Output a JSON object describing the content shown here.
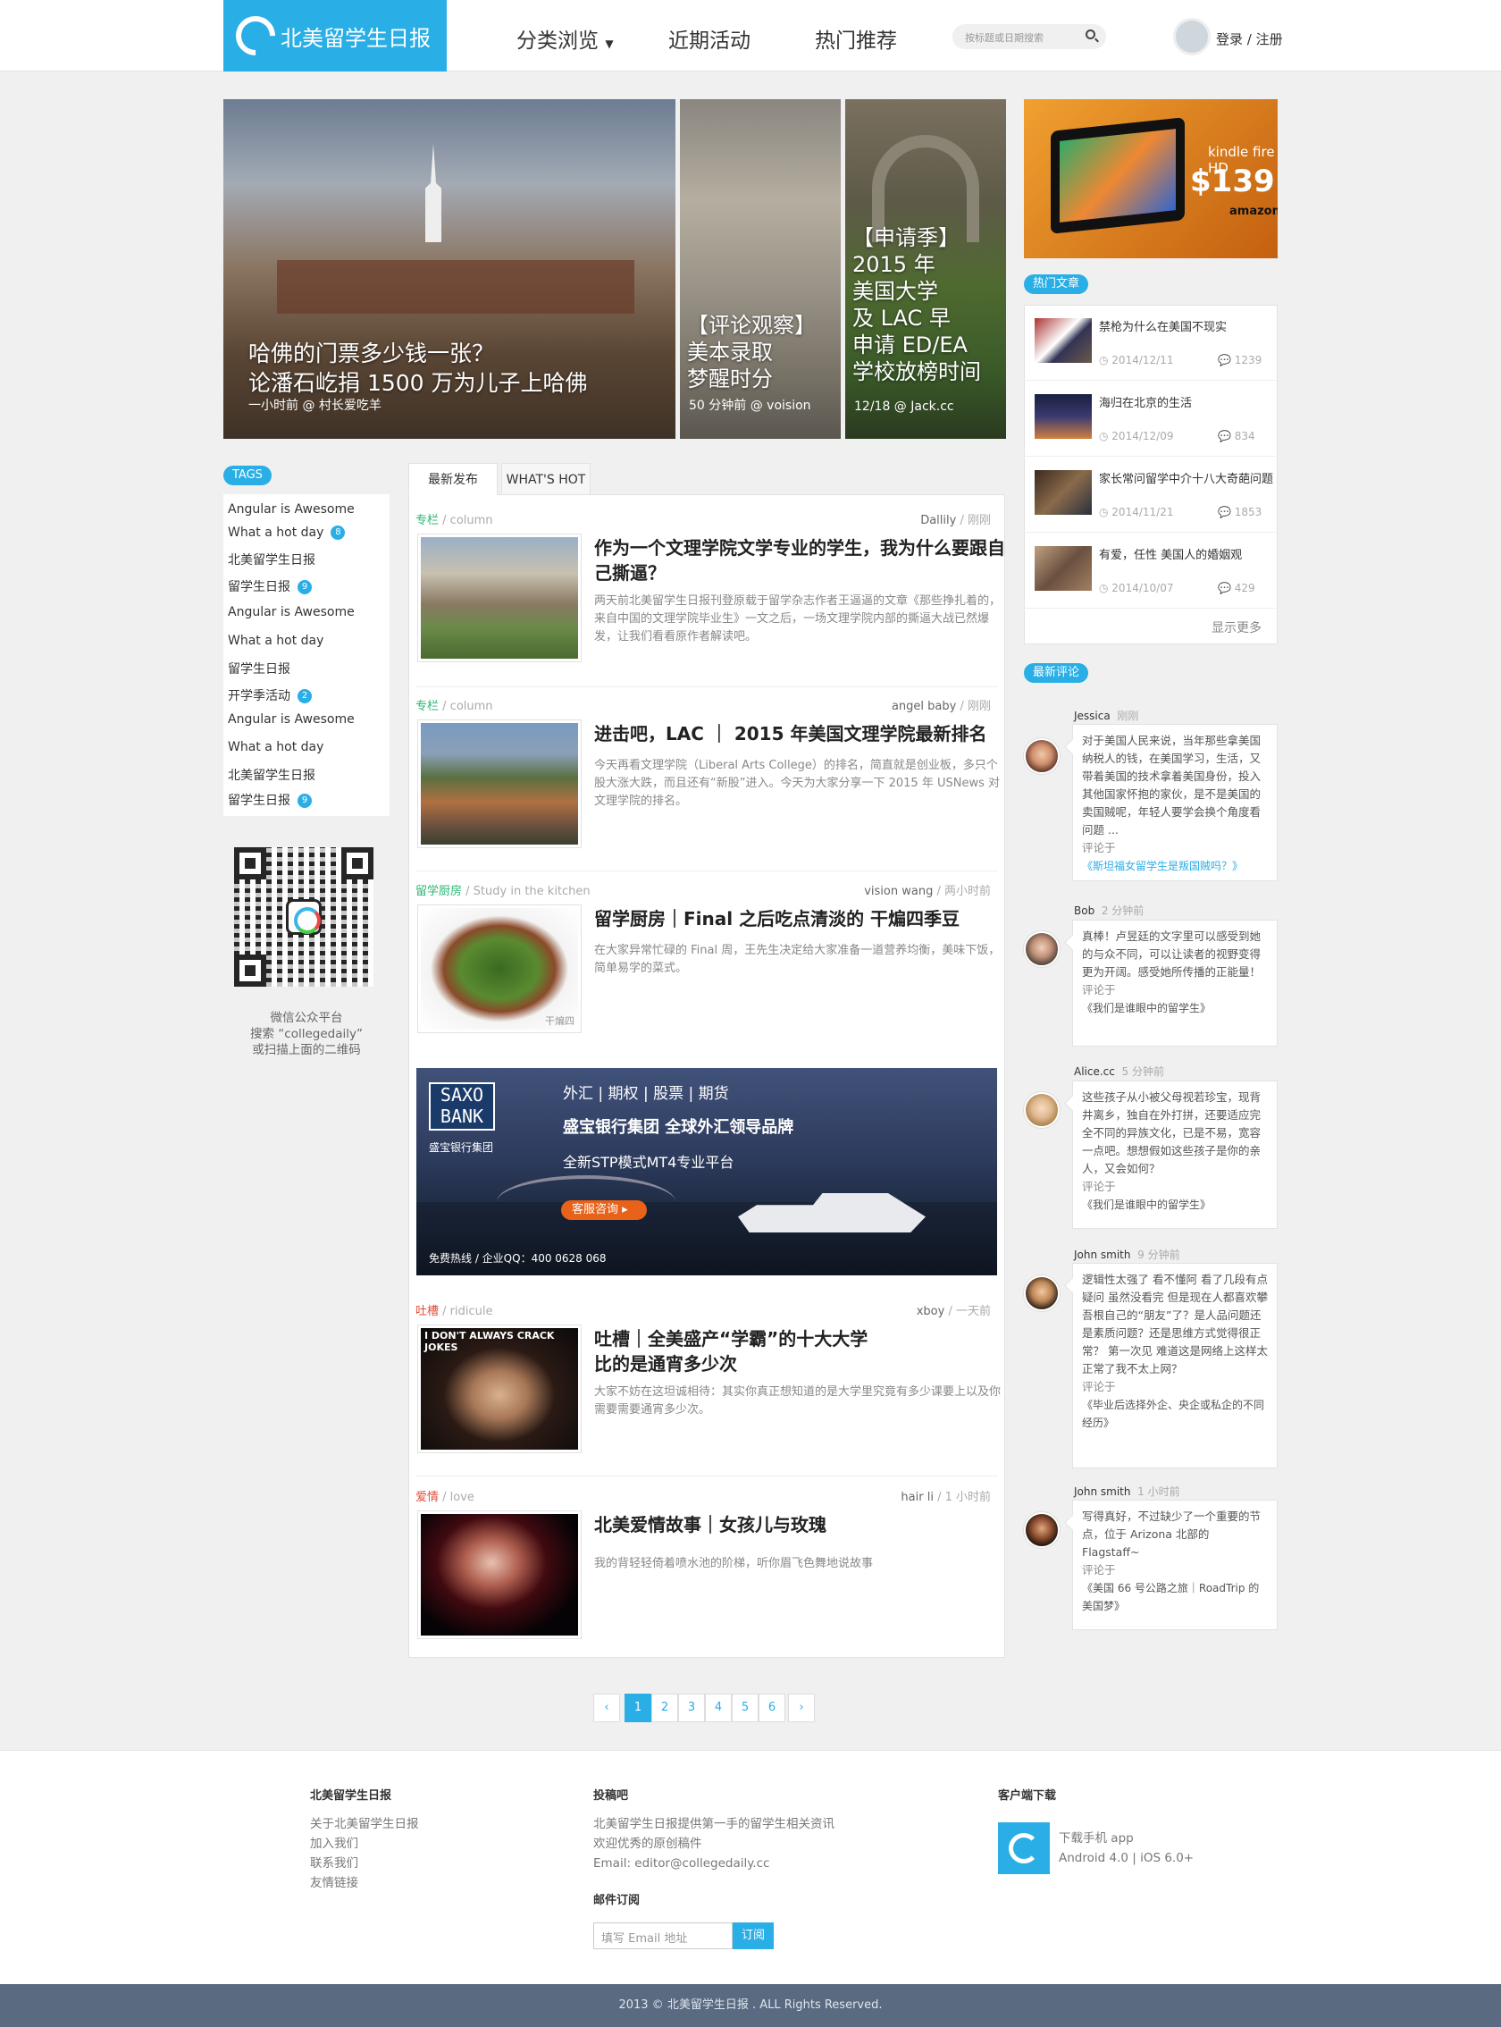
{
  "header": {
    "logo": "北美留学生日报",
    "nav": [
      "分类浏览",
      "近期活动",
      "热门推荐"
    ],
    "search_placeholder": "按标题或日期搜索",
    "login": "登录 / 注册"
  },
  "hero": [
    {
      "title": "哈佛的门票多少钱一张？\n论潘石屹捐 1500 万为儿子上哈佛",
      "meta": "一小时前 @ 村长爱吃羊"
    },
    {
      "title": "【评论观察】\n美本录取\n梦醒时分",
      "meta": "50 分钟前 @ voision"
    },
    {
      "title": "【申请季】\n2015 年\n美国大学\n及 LAC 早\n申请 ED/EA\n学校放榜时间",
      "meta": "12/18 @ Jack.cc"
    }
  ],
  "ad": {
    "brand": "kindle fire HD",
    "price": "$139",
    "vendor": "amazon"
  },
  "hot_articles": {
    "label": "热门文章",
    "items": [
      {
        "title": "禁枪为什么在美国不现实",
        "date": "2014/12/11",
        "comments": "1239"
      },
      {
        "title": "海归在北京的生活",
        "date": "2014/12/09",
        "comments": "834"
      },
      {
        "title": "家长常问留学中介十八大奇葩问题",
        "date": "2014/11/21",
        "comments": "1853"
      },
      {
        "title": "有爱，任性 美国人的婚姻观",
        "date": "2014/10/07",
        "comments": "429"
      }
    ],
    "more": "显示更多"
  },
  "tags": {
    "label": "TAGS",
    "items": [
      {
        "name": "Angular is Awesome",
        "count": ""
      },
      {
        "name": "What a hot day",
        "count": "8"
      },
      {
        "name": "北美留学生日报",
        "count": ""
      },
      {
        "name": "留学生日报",
        "count": "9"
      },
      {
        "name": "Angular is Awesome",
        "count": ""
      },
      {
        "name": "What a hot day",
        "count": ""
      },
      {
        "name": "留学生日报",
        "count": ""
      },
      {
        "name": "开学季活动",
        "count": "2"
      },
      {
        "name": "Angular is Awesome",
        "count": ""
      },
      {
        "name": "What a hot day",
        "count": ""
      },
      {
        "name": "北美留学生日报",
        "count": ""
      },
      {
        "name": "留学生日报",
        "count": "9"
      }
    ]
  },
  "qr": {
    "line1": "微信公众平台",
    "line2": "搜索 “collegedaily”",
    "line3": "或扫描上面的二维码"
  },
  "tabs": [
    "最新发布",
    "WHAT'S HOT"
  ],
  "articles": [
    {
      "cat": "专栏",
      "cat_en": "column",
      "author": "Dallily",
      "time": "刚刚",
      "title": "作为一个文理学院文学专业的学生，我为什么要跟自己撕逼？",
      "excerpt": "两天前北美留学生日报刊登原载于留学杂志作者王逼逼的文章《那些挣扎着的，来自中国的文理学院毕业生》一文之后，一场文理学院内部的撕逼大战已然爆发，让我们看看原作者解读吧。"
    },
    {
      "cat": "专栏",
      "cat_en": "column",
      "author": "angel baby",
      "time": "刚刚",
      "title": "进击吧，LAC ｜ 2015 年美国文理学院最新排名",
      "excerpt": "今天再看文理学院（Liberal Arts College）的排名，简直就是创业板，多只个股大涨大跌，而且还有“新股”进入。今天为大家分享一下 2015 年 USNews 对文理学院的排名。"
    },
    {
      "cat": "留学厨房",
      "cat_en": "Study in the kitchen",
      "author": "vision wang",
      "time": "两小时前",
      "title": "留学厨房｜Final 之后吃点清淡的 干煸四季豆",
      "excerpt": "在大家异常忙碌的 Final 周，王先生决定给大家准备一道营养均衡，美味下饭，简单易学的菜式。",
      "img_caption": "干煸四"
    },
    {
      "cat": "吐槽",
      "cat_en": "ridicule",
      "author": "xboy",
      "time": "一天前",
      "title": "吐槽｜全美盛产“学霸”的十大大学\n比的是通宵多少次",
      "excerpt": "大家不妨在这坦诚相待：其实你真正想知道的是大学里究竟有多少课要上以及你需要需要通宵多少次。",
      "img_caption": "I DON'T ALWAYS CRACK JOKES"
    },
    {
      "cat": "爱情",
      "cat_en": "love",
      "author": "hair li",
      "time": "1 小时前",
      "title": "北美爱情故事｜女孩儿与玫瑰",
      "excerpt": "我的背轻轻倚着喷水池的阶梯，听你眉飞色舞地说故事"
    }
  ],
  "banner": {
    "logo": "SAXO\nBANK",
    "sub": "盛宝银行集团",
    "line1": "外汇 | 期权 | 股票 | 期货",
    "line2": "盛宝银行集团 全球外汇领导品牌",
    "line3": "全新STP模式MT4专业平台",
    "button": "客服咨询",
    "contact": "免费热线 / 企业QQ：400 0628 068"
  },
  "latest_comments": {
    "label": "最新评论",
    "items": [
      {
        "user": "Jessica",
        "time": "刚刚",
        "text": "对于美国人民来说，当年那些拿美国纳税人的钱，在美国学习，生活，又带着美国的技术拿着美国身份，投入其他国家怀抱的家伙，是不是美国的卖国贼呢，年轻人要学会换个角度看问题 ...",
        "on": "评论于",
        "post": "《斯坦福女留学生是叛国贼吗？》"
      },
      {
        "user": "Bob",
        "time": "2 分钟前",
        "text": "真棒！卢昱廷的文字里可以感受到她的与众不同，可以让读者的视野变得更为开阔。感受她所传播的正能量！",
        "on": "评论于",
        "post": "《我们是谁眼中的留学生》"
      },
      {
        "user": "Alice.cc",
        "time": "5 分钟前",
        "text": "这些孩子从小被父母视若珍宝，现背井离乡，独自在外打拼，还要适应完全不同的异族文化，已是不易，宽容一点吧。想想假如这些孩子是你的亲人，又会如何？",
        "on": "评论于",
        "post": "《我们是谁眼中的留学生》"
      },
      {
        "user": "John smith",
        "time": "9 分钟前",
        "text": "逻辑性太强了 看不懂阿 看了几段有点疑问 虽然没看完 但是现在人都喜欢攀吾根自己的“朋友”了？是人品问题还是素质问题？还是思维方式觉得很正常？ 第一次见 难道这是网络上这样太正常了我不太上网？",
        "on": "评论于",
        "post": "《毕业后选择外企、央企或私企的不同经历》"
      },
      {
        "user": "John smith",
        "time": "1 小时前",
        "text": "写得真好，不过缺少了一个重要的节点，位于 Arizona 北部的 Flagstaff~",
        "on": "评论于",
        "post": "《美国 66 号公路之旅｜RoadTrip 的美国梦》"
      }
    ]
  },
  "pagination": {
    "prev": "‹",
    "pages": [
      "1",
      "2",
      "3",
      "4",
      "5",
      "6"
    ],
    "next": "›",
    "current": "1"
  },
  "footer": {
    "col1_title": "北美留学生日报",
    "col1_links": [
      "关于北美留学生日报",
      "加入我们",
      "联系我们",
      "友情链接"
    ],
    "col2_title": "投稿吧",
    "col2_lines": [
      "北美留学生日报提供第一手的留学生相关资讯",
      "欢迎优秀的原创稿件",
      "Email: editor@collegedaily.cc"
    ],
    "sub_title": "邮件订阅",
    "email_placeholder": "填写 Email 地址",
    "sub_button": "订阅",
    "col3_title": "客户端下载",
    "app_line1": "下载手机 app",
    "app_line2": "Android 4.0 | iOS 6.0+",
    "copyright": "2013 © 北美留学生日报 . ALL Rights Reserved."
  },
  "colors": {
    "accent": "#2aaee6",
    "footer_bar": "#5a6a80",
    "red_cat": "#e34d3b",
    "green_cat": "#2bb673"
  }
}
